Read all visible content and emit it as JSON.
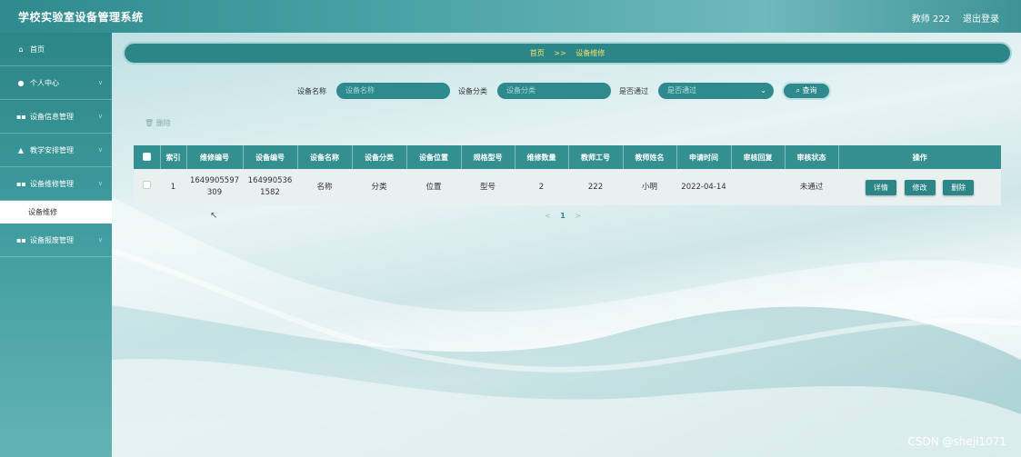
{
  "header": {
    "app_title": "学校实验室设备管理系统",
    "user_label": "教师 222",
    "logout_label": "退出登录"
  },
  "sidebar": {
    "items": [
      {
        "icon": "home-icon",
        "label": "首页"
      },
      {
        "icon": "user-icon",
        "label": "个人中心"
      },
      {
        "icon": "grid-icon",
        "label": "设备信息管理"
      },
      {
        "icon": "school-icon",
        "label": "教学安排管理"
      },
      {
        "icon": "grid-icon",
        "label": "设备维修管理"
      },
      {
        "icon": "grid-icon",
        "label": "设备报废管理"
      }
    ],
    "active_sub_item": "设备维修"
  },
  "breadcrumb": {
    "home": "首页",
    "separator": ">>",
    "current": "设备维修"
  },
  "search": {
    "name_label": "设备名称",
    "name_placeholder": "设备名称",
    "category_label": "设备分类",
    "category_placeholder": "设备分类",
    "passed_label": "是否通过",
    "passed_placeholder": "是否通过",
    "query_button": "查询"
  },
  "toolbar": {
    "delete_label": "删除"
  },
  "table": {
    "columns": [
      "索引",
      "维修编号",
      "设备编号",
      "设备名称",
      "设备分类",
      "设备位置",
      "规格型号",
      "维修数量",
      "教师工号",
      "教师姓名",
      "申请时间",
      "审核回复",
      "审核状态",
      "操作"
    ],
    "rows": [
      {
        "index": "1",
        "repair_no_1": "1649905597",
        "repair_no_2": "309",
        "device_no_1": "164990536",
        "device_no_2": "1582",
        "name": "名称",
        "category": "分类",
        "location": "位置",
        "model": "型号",
        "quantity": "2",
        "teacher_id": "222",
        "teacher_name": "小明",
        "apply_time": "2022-04-14",
        "reply": "",
        "status": "未通过",
        "actions": {
          "detail": "详情",
          "edit": "修改",
          "delete": "删除"
        }
      }
    ]
  },
  "pagination": {
    "prev": "<",
    "current": "1",
    "next": ">"
  },
  "watermark": "CSDN @sheji1071"
}
